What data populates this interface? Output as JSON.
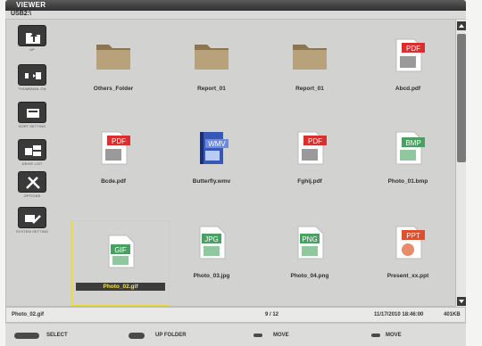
{
  "window": {
    "title": "VIEWER",
    "path": "USB2:\\"
  },
  "sidebar": {
    "items": [
      {
        "label": "UP",
        "icon": "folder-up-icon"
      },
      {
        "label": "THUMBNAIL ON",
        "icon": "thumbnail-icon"
      },
      {
        "label": "SORT SETTING",
        "icon": "sort-icon"
      },
      {
        "label": "DRIVE LIST",
        "icon": "drive-list-icon"
      },
      {
        "label": "OPTIONS",
        "icon": "options-icon"
      },
      {
        "label": "SYSTEM SETTING",
        "icon": "system-setting-icon"
      }
    ]
  },
  "files": [
    {
      "name": "Others_Folder",
      "type": "folder",
      "badge": ""
    },
    {
      "name": "Report_01",
      "type": "folder",
      "badge": ""
    },
    {
      "name": "Report_01",
      "type": "folder",
      "badge": ""
    },
    {
      "name": "Abcd.pdf",
      "type": "pdf",
      "badge": "PDF"
    },
    {
      "name": "Bcde.pdf",
      "type": "pdf",
      "badge": "PDF"
    },
    {
      "name": "Butterfly.wmv",
      "type": "wmv",
      "badge": "WMV"
    },
    {
      "name": "Fghij.pdf",
      "type": "pdf",
      "badge": "PDF"
    },
    {
      "name": "Photo_01.bmp",
      "type": "image",
      "badge": "BMP"
    },
    {
      "name": "Photo_02.gif",
      "type": "image",
      "badge": "GIF",
      "selected": true
    },
    {
      "name": "Photo_03.jpg",
      "type": "image",
      "badge": "JPG"
    },
    {
      "name": "Photo_04.png",
      "type": "image",
      "badge": "PNG"
    },
    {
      "name": "Present_xx.ppt",
      "type": "ppt",
      "badge": "PPT"
    }
  ],
  "status": {
    "selected_file": "Photo_02.gif",
    "position": "9 / 12",
    "timestamp": "11/17/2010 18:46:00",
    "size": "401KB"
  },
  "help": {
    "select": "SELECT",
    "up_folder": "UP FOLDER",
    "move_1": "MOVE",
    "move_2": "MOVE"
  },
  "colors": {
    "folder": "#a58f6a",
    "pdf": "#d92f2f",
    "wmv": "#3858b8",
    "image": "#4aa063",
    "selection": "#e9dc3a"
  }
}
